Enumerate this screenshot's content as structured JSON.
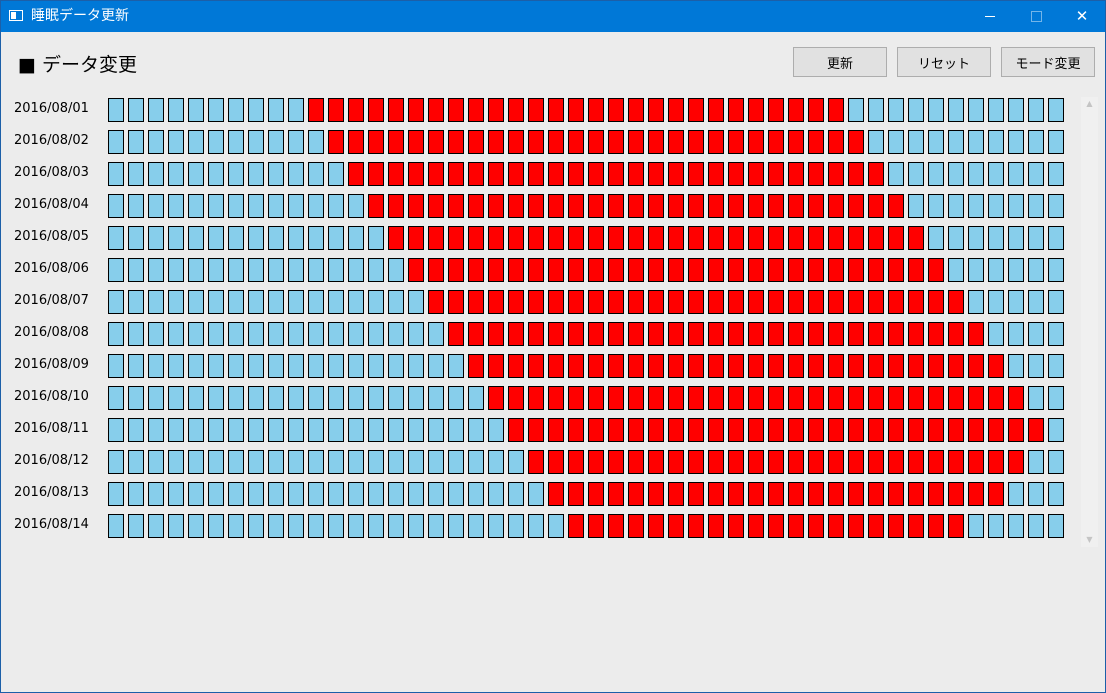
{
  "window": {
    "title": "睡眠データ更新"
  },
  "header": {
    "label": "■ データ変更"
  },
  "toolbar": {
    "update_label": "更新",
    "reset_label": "リセット",
    "mode_label": "モード変更"
  },
  "colors": {
    "asleep": "#ff0000",
    "awake": "#87ceeb",
    "titlebar": "#0078d7"
  },
  "grid": {
    "slots_per_day": 48,
    "rows": [
      {
        "date": "2016/08/01",
        "asleep_start_slot": 10,
        "asleep_slots": 27
      },
      {
        "date": "2016/08/02",
        "asleep_start_slot": 11,
        "asleep_slots": 27
      },
      {
        "date": "2016/08/03",
        "asleep_start_slot": 12,
        "asleep_slots": 27
      },
      {
        "date": "2016/08/04",
        "asleep_start_slot": 13,
        "asleep_slots": 27
      },
      {
        "date": "2016/08/05",
        "asleep_start_slot": 14,
        "asleep_slots": 27
      },
      {
        "date": "2016/08/06",
        "asleep_start_slot": 15,
        "asleep_slots": 27
      },
      {
        "date": "2016/08/07",
        "asleep_start_slot": 16,
        "asleep_slots": 27
      },
      {
        "date": "2016/08/08",
        "asleep_start_slot": 17,
        "asleep_slots": 27
      },
      {
        "date": "2016/08/09",
        "asleep_start_slot": 18,
        "asleep_slots": 27
      },
      {
        "date": "2016/08/10",
        "asleep_start_slot": 19,
        "asleep_slots": 27
      },
      {
        "date": "2016/08/11",
        "asleep_start_slot": 20,
        "asleep_slots": 27
      },
      {
        "date": "2016/08/12",
        "asleep_start_slot": 21,
        "asleep_slots": 25
      },
      {
        "date": "2016/08/13",
        "asleep_start_slot": 22,
        "asleep_slots": 23
      },
      {
        "date": "2016/08/14",
        "asleep_start_slot": 23,
        "asleep_slots": 20
      }
    ]
  }
}
